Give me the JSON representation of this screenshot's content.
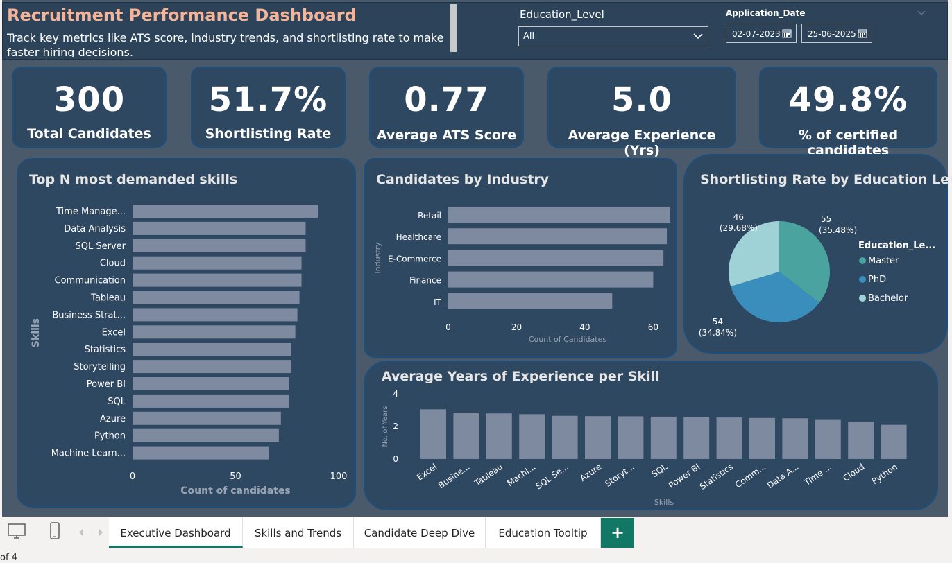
{
  "header": {
    "title": "Recruitment Performance Dashboard",
    "subtitle": "Track key metrics like ATS score, industry trends, and shortlisting rate to make faster hiring decisions."
  },
  "filters": {
    "education_label": "Education_Level",
    "education_value": "All",
    "date_label": "Application_Date",
    "date_start": "02-07-2023",
    "date_end": "25-06-2025"
  },
  "kpis": [
    {
      "value": "300",
      "label": "Total Candidates"
    },
    {
      "value": "51.7%",
      "label": "Shortlisting Rate"
    },
    {
      "value": "0.77",
      "label": "Average ATS Score"
    },
    {
      "value": "5.0",
      "label": "Average Experience (Yrs)"
    },
    {
      "value": "49.8%",
      "label": "% of certified candidates"
    }
  ],
  "chart_data": [
    {
      "id": "skills",
      "type": "bar",
      "orientation": "horizontal",
      "title": "Top N most demanded skills",
      "xlabel": "Count of candidates",
      "ylabel": "Skills",
      "xlim": [
        0,
        100
      ],
      "xticks": [
        "0",
        "50",
        "100"
      ],
      "categories": [
        "Time Manage...",
        "Data Analysis",
        "SQL Server",
        "Cloud",
        "Communication",
        "Tableau",
        "Business Strat...",
        "Excel",
        "Statistics",
        "Storytelling",
        "Power BI",
        "SQL",
        "Azure",
        "Python",
        "Machine Learn..."
      ],
      "values": [
        90,
        84,
        84,
        82,
        82,
        81,
        80,
        79,
        77,
        77,
        76,
        76,
        72,
        71,
        66
      ],
      "color": "#7d8aa0"
    },
    {
      "id": "industry",
      "type": "bar",
      "orientation": "horizontal",
      "title": "Candidates by Industry",
      "xlabel": "Count of Candidates",
      "ylabel": "Industry",
      "xlim": [
        0,
        65
      ],
      "xticks": [
        "0",
        "20",
        "40",
        "60"
      ],
      "categories": [
        "Retail",
        "Healthcare",
        "E-Commerce",
        "Finance",
        "IT"
      ],
      "values": [
        65,
        64,
        63,
        60,
        48
      ],
      "color": "#7d8aa0"
    },
    {
      "id": "education",
      "type": "pie",
      "title": "Shortlisting Rate by Education Level",
      "legend_title": "Education_Le...",
      "legend_position": "right",
      "slices": [
        {
          "name": "Master",
          "value": 55,
          "label": "55",
          "pct": "(35.48%)",
          "color": "#4aa39f"
        },
        {
          "name": "PhD",
          "value": 54,
          "label": "54",
          "pct": "(34.84%)",
          "color": "#3a8ebb"
        },
        {
          "name": "Bachelor",
          "value": 46,
          "label": "46",
          "pct": "(29.68%)",
          "color": "#9ed2d6"
        }
      ]
    },
    {
      "id": "experience",
      "type": "bar",
      "orientation": "vertical",
      "title": "Average Years of Experience per Skill",
      "xlabel": "Skills",
      "ylabel": "No. of Years",
      "ylim": [
        0,
        4
      ],
      "yticks": [
        "0",
        "2",
        "4"
      ],
      "categories": [
        "Excel",
        "Busine...",
        "Tableau",
        "Machi...",
        "SQL Se...",
        "Azure",
        "Storyt...",
        "SQL",
        "Power BI",
        "Statistics",
        "Comm...",
        "Data A...",
        "Time ...",
        "Cloud",
        "Python"
      ],
      "values": [
        3.05,
        2.85,
        2.8,
        2.75,
        2.65,
        2.63,
        2.62,
        2.6,
        2.58,
        2.55,
        2.52,
        2.5,
        2.4,
        2.3,
        2.1
      ],
      "color": "#7d8aa0"
    }
  ],
  "tabs": [
    {
      "label": "Executive Dashboard",
      "active": true
    },
    {
      "label": "Skills and Trends",
      "active": false
    },
    {
      "label": "Candidate Deep Dive",
      "active": false
    },
    {
      "label": "Education Tooltip",
      "active": false
    }
  ],
  "add_tab_label": "+",
  "status_text": "of 4",
  "icons": {
    "desktop": "desktop-icon",
    "phone": "phone-icon",
    "prev": "chevron-left-icon",
    "next": "chevron-right-icon",
    "calendar": "calendar-icon",
    "dropdown": "chevron-down-icon"
  }
}
